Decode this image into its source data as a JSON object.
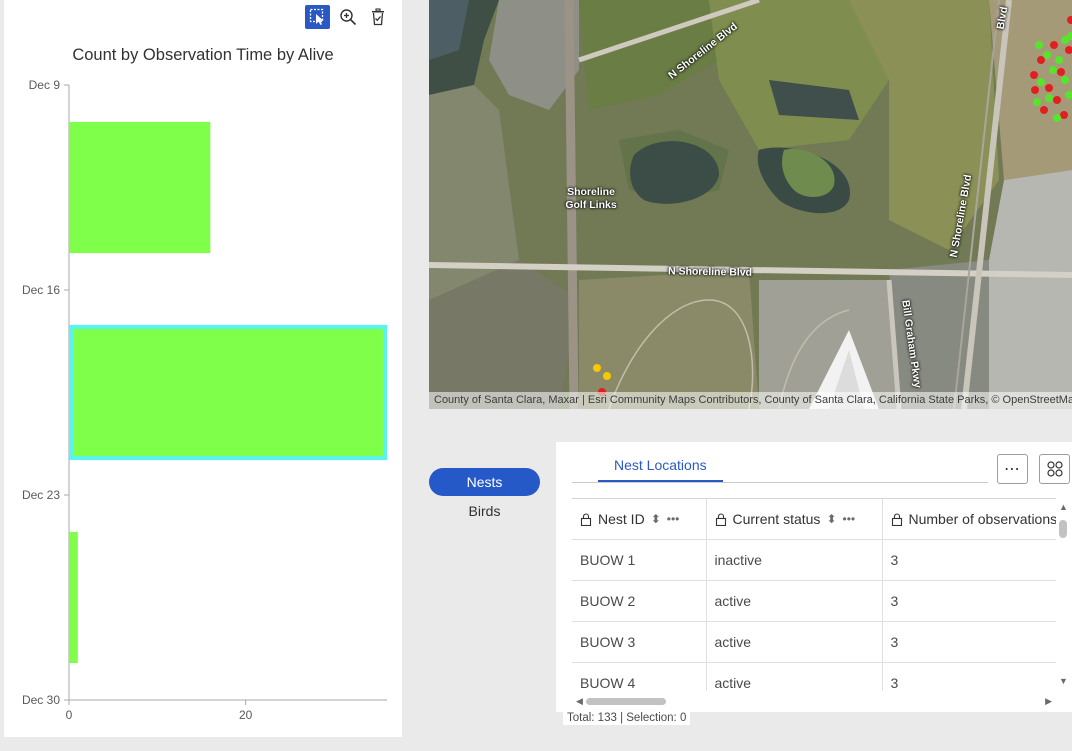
{
  "chart": {
    "toolbar": {
      "select_icon": "select-by-rectangle-icon",
      "zoom_icon": "zoom-in-icon",
      "clear_icon": "clear-selection-icon"
    },
    "title": "Count by Observation Time by Alive",
    "chart_data": {
      "type": "bar",
      "orientation": "horizontal",
      "title": "Count by Observation Time by Alive",
      "y_tick_labels": [
        "Dec 9",
        "Dec 16",
        "Dec 23",
        "Dec 30"
      ],
      "x_tick_labels": [
        "0",
        "20"
      ],
      "xlim": [
        0,
        36
      ],
      "bars": [
        {
          "period": "Dec 10 – Dec 16",
          "value": 16,
          "selected": false
        },
        {
          "period": "Dec 17 – Dec 23",
          "value": 36,
          "selected": true
        },
        {
          "period": "Dec 24 – Dec 30",
          "value": 1,
          "selected": false
        }
      ],
      "bar_color": "#7fff4a",
      "selection_color": "#5bf2f2"
    }
  },
  "map": {
    "labels": {
      "road_a": "N Shoreline Blvd",
      "road_b": "N Shoreline Blvd",
      "road_c": "N Shoreline Blvd",
      "road_d": "Bill Graham Pkwy",
      "road_e": "Blvd",
      "golf": "Shoreline Golf Links"
    },
    "attribution": "County of Santa Clara, Maxar | Esri Community Maps Contributors, County of Santa Clara, California State Parks, © OpenStreetMap"
  },
  "layers": {
    "items": [
      {
        "label": "Nests",
        "active": true
      },
      {
        "label": "Birds",
        "active": false
      }
    ]
  },
  "table": {
    "tab_label": "Nest Locations",
    "more_icon": "ellipsis-icon",
    "layout_icon": "grid-layout-icon",
    "columns": [
      "Nest ID",
      "Current status",
      "Number of observations"
    ],
    "rows": [
      [
        "BUOW 1",
        "inactive",
        "3"
      ],
      [
        "BUOW 2",
        "active",
        "3"
      ],
      [
        "BUOW 3",
        "active",
        "3"
      ],
      [
        "BUOW 4",
        "active",
        "3"
      ]
    ],
    "footer": "Total: 133 | Selection: 0"
  }
}
